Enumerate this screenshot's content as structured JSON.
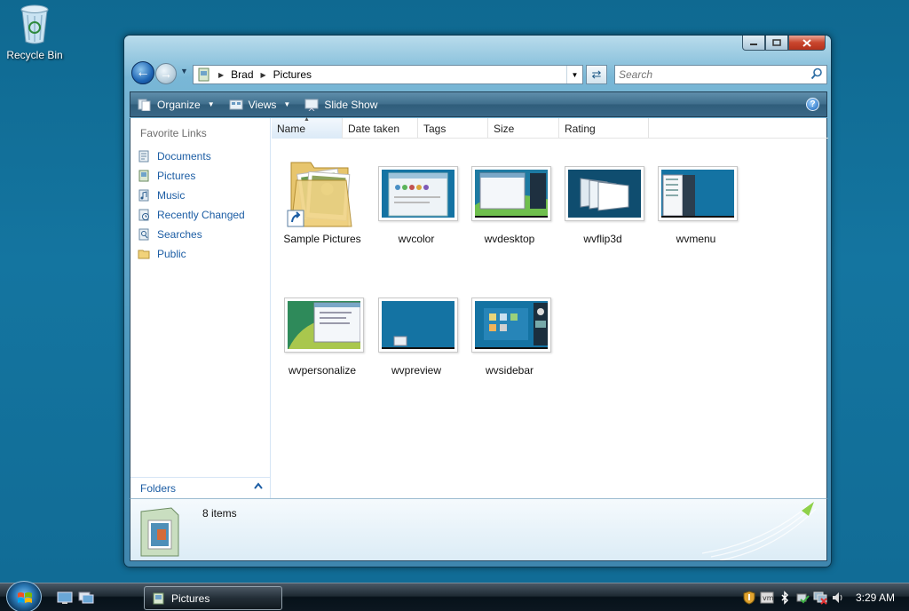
{
  "desktop": {
    "icons": [
      {
        "label": "Recycle Bin",
        "icon": "recycle-bin-icon"
      }
    ]
  },
  "window": {
    "title": "Pictures",
    "caption_buttons": [
      "minimize",
      "maximize",
      "close"
    ],
    "address": {
      "crumbs": [
        "Brad",
        "Pictures"
      ]
    },
    "search": {
      "placeholder": "Search"
    },
    "toolbar": {
      "organize": "Organize",
      "views": "Views",
      "slideshow": "Slide Show"
    },
    "nav": {
      "favorites_heading": "Favorite Links",
      "links": [
        {
          "label": "Documents",
          "icon": "documents-icon"
        },
        {
          "label": "Pictures",
          "icon": "pictures-icon"
        },
        {
          "label": "Music",
          "icon": "music-icon"
        },
        {
          "label": "Recently Changed",
          "icon": "recently-changed-icon"
        },
        {
          "label": "Searches",
          "icon": "searches-icon"
        },
        {
          "label": "Public",
          "icon": "folder-icon"
        }
      ],
      "folders_label": "Folders"
    },
    "columns": [
      "Name",
      "Date taken",
      "Tags",
      "Size",
      "Rating"
    ],
    "sorted_column": "Name",
    "items": [
      {
        "label": "Sample Pictures",
        "type": "folder-shortcut"
      },
      {
        "label": "wvcolor",
        "type": "image"
      },
      {
        "label": "wvdesktop",
        "type": "image"
      },
      {
        "label": "wvflip3d",
        "type": "image"
      },
      {
        "label": "wvmenu",
        "type": "image"
      },
      {
        "label": "wvpersonalize",
        "type": "image"
      },
      {
        "label": "wvpreview",
        "type": "image"
      },
      {
        "label": "wvsidebar",
        "type": "image"
      }
    ],
    "details": {
      "count": "8 items"
    }
  },
  "taskbar": {
    "start": "start-orb-icon",
    "quick_launch": [
      "show-desktop-icon",
      "switch-windows-icon"
    ],
    "task_buttons": [
      {
        "label": "Pictures"
      }
    ],
    "tray_icons": [
      "security-shield-icon",
      "vm-icon",
      "bluetooth-icon",
      "network-check-icon",
      "network-disconnected-icon",
      "volume-icon"
    ],
    "clock": "3:29 AM"
  },
  "colors": {
    "desktop": "#1475a0",
    "link": "#1c5da4",
    "toolbar": "#3f6e8c"
  }
}
